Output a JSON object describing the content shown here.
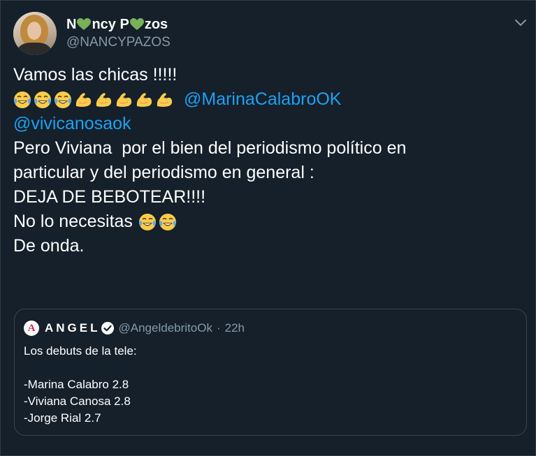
{
  "author": {
    "display_name_parts": [
      "N",
      "ncy P",
      "zos"
    ],
    "handle": "@NANCYPAZOS"
  },
  "tweet": {
    "line1": "Vamos las chicas !!!!!",
    "mention1": "@MarinaCalabroOK",
    "mention2": "@vivicanosaok",
    "line3": "Pero Viviana  por el bien del periodismo político en",
    "line4": "particular y del periodismo en general :",
    "line5": "DEJA DE BEBOTEAR!!!!",
    "line6": "No lo necesitas",
    "line7": "De onda."
  },
  "quote": {
    "logo_letter": "A",
    "name": "ANGEL",
    "handle": "@AngeldebritoOk",
    "separator": "·",
    "time": "22h",
    "lines": [
      "Los debuts de la tele:",
      "",
      "-Marina Calabro 2.8",
      "-Viviana Canosa 2.8",
      "-Jorge Rial 2.7"
    ]
  },
  "colors": {
    "background": "#15202b",
    "mention": "#1da1f2",
    "secondary_text": "#8899a6",
    "heart": "#78b159"
  },
  "icons": [
    "green-heart-icon",
    "chevron-down-icon",
    "laughing-tears-emoji-icon",
    "flexed-biceps-emoji-icon",
    "verified-badge-icon"
  ]
}
